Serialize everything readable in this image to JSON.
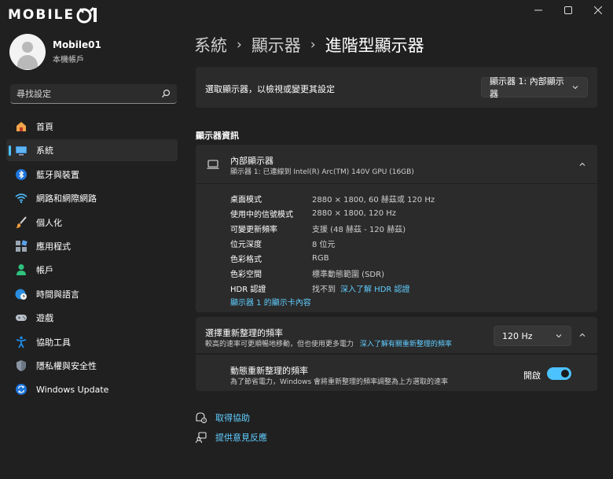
{
  "app": {
    "logo_text": "MOBILE",
    "window_buttons": [
      "minimize-icon",
      "maximize-icon",
      "close-icon"
    ]
  },
  "profile": {
    "name": "Mobile01",
    "account_type": "本機帳戶"
  },
  "search": {
    "placeholder": "尋找設定"
  },
  "sidebar": {
    "accent_color": "#4cc2ff",
    "items": [
      {
        "label": "首頁",
        "icon": "home-icon"
      },
      {
        "label": "系統",
        "icon": "system-icon",
        "active": true
      },
      {
        "label": "藍牙與裝置",
        "icon": "bluetooth-icon"
      },
      {
        "label": "網路和網際網路",
        "icon": "wifi-icon"
      },
      {
        "label": "個人化",
        "icon": "brush-icon"
      },
      {
        "label": "應用程式",
        "icon": "apps-icon"
      },
      {
        "label": "帳戶",
        "icon": "account-icon"
      },
      {
        "label": "時間與語言",
        "icon": "globe-clock-icon"
      },
      {
        "label": "遊戲",
        "icon": "gamepad-icon"
      },
      {
        "label": "協助工具",
        "icon": "accessibility-icon"
      },
      {
        "label": "隱私權與安全性",
        "icon": "shield-icon"
      },
      {
        "label": "Windows Update",
        "icon": "update-icon"
      }
    ]
  },
  "breadcrumb": {
    "items": [
      "系統",
      "顯示器",
      "進階型顯示器"
    ],
    "separator": "›"
  },
  "display_select": {
    "label": "選取顯示器，以檢視或變更其設定",
    "value": "顯示器 1: 內部顯示器"
  },
  "display_info": {
    "section_title": "顯示器資訊",
    "title": "內部顯示器",
    "subtitle": "顯示器 1: 已連線到 Intel(R) Arc(TM) 140V GPU (16GB)",
    "specs": [
      {
        "key": "桌面模式",
        "value": "2880 × 1800, 60 赫茲或 120 Hz"
      },
      {
        "key": "使用中的信號模式",
        "value": "2880 × 1800, 120 Hz"
      },
      {
        "key": "可變更新頻率",
        "value": "支援 (48 赫茲 - 120 赫茲)"
      },
      {
        "key": "位元深度",
        "value": "8 位元"
      },
      {
        "key": "色彩格式",
        "value": "RGB"
      },
      {
        "key": "色彩空間",
        "value": "標準動態範圍 (SDR)"
      },
      {
        "key": "HDR 認證",
        "value": "找不到",
        "link": "深入了解 HDR 認證"
      }
    ],
    "adapter_link": "顯示器 1 的顯示卡內容"
  },
  "refresh_rate": {
    "title": "選擇重新整理的頻率",
    "subtitle": "較高的速率可更順暢地移動，但也使用更多電力",
    "link": "深入了解有關重新整理的頻率",
    "value": "120 Hz"
  },
  "dynamic_refresh": {
    "title": "動態重新整理的頻率",
    "subtitle": "為了節省電力，Windows 會將重新整理的頻率調整為上方選取的速率",
    "state_label": "開啟",
    "enabled": true
  },
  "help": {
    "get_help": "取得協助",
    "feedback": "提供意見反應"
  }
}
